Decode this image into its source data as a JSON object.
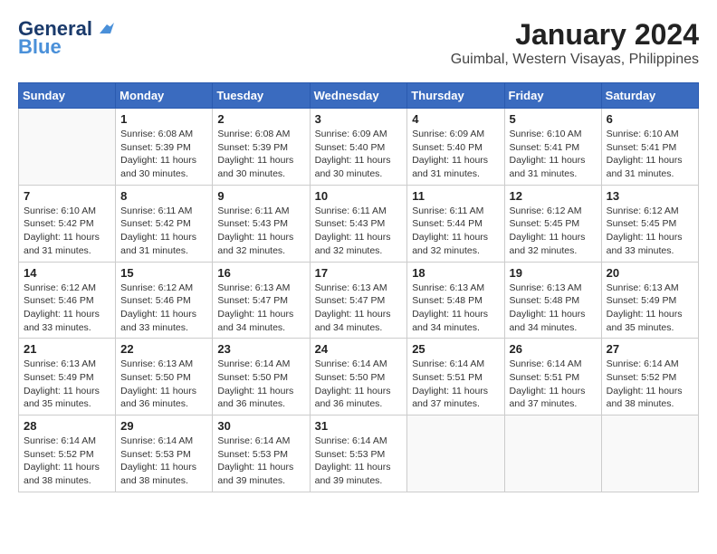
{
  "logo": {
    "line1": "General",
    "line2": "Blue"
  },
  "title": "January 2024",
  "subtitle": "Guimbal, Western Visayas, Philippines",
  "days_of_week": [
    "Sunday",
    "Monday",
    "Tuesday",
    "Wednesday",
    "Thursday",
    "Friday",
    "Saturday"
  ],
  "weeks": [
    [
      {
        "day": "",
        "info": ""
      },
      {
        "day": "1",
        "info": "Sunrise: 6:08 AM\nSunset: 5:39 PM\nDaylight: 11 hours\nand 30 minutes."
      },
      {
        "day": "2",
        "info": "Sunrise: 6:08 AM\nSunset: 5:39 PM\nDaylight: 11 hours\nand 30 minutes."
      },
      {
        "day": "3",
        "info": "Sunrise: 6:09 AM\nSunset: 5:40 PM\nDaylight: 11 hours\nand 30 minutes."
      },
      {
        "day": "4",
        "info": "Sunrise: 6:09 AM\nSunset: 5:40 PM\nDaylight: 11 hours\nand 31 minutes."
      },
      {
        "day": "5",
        "info": "Sunrise: 6:10 AM\nSunset: 5:41 PM\nDaylight: 11 hours\nand 31 minutes."
      },
      {
        "day": "6",
        "info": "Sunrise: 6:10 AM\nSunset: 5:41 PM\nDaylight: 11 hours\nand 31 minutes."
      }
    ],
    [
      {
        "day": "7",
        "info": "Sunrise: 6:10 AM\nSunset: 5:42 PM\nDaylight: 11 hours\nand 31 minutes."
      },
      {
        "day": "8",
        "info": "Sunrise: 6:11 AM\nSunset: 5:42 PM\nDaylight: 11 hours\nand 31 minutes."
      },
      {
        "day": "9",
        "info": "Sunrise: 6:11 AM\nSunset: 5:43 PM\nDaylight: 11 hours\nand 32 minutes."
      },
      {
        "day": "10",
        "info": "Sunrise: 6:11 AM\nSunset: 5:43 PM\nDaylight: 11 hours\nand 32 minutes."
      },
      {
        "day": "11",
        "info": "Sunrise: 6:11 AM\nSunset: 5:44 PM\nDaylight: 11 hours\nand 32 minutes."
      },
      {
        "day": "12",
        "info": "Sunrise: 6:12 AM\nSunset: 5:45 PM\nDaylight: 11 hours\nand 32 minutes."
      },
      {
        "day": "13",
        "info": "Sunrise: 6:12 AM\nSunset: 5:45 PM\nDaylight: 11 hours\nand 33 minutes."
      }
    ],
    [
      {
        "day": "14",
        "info": "Sunrise: 6:12 AM\nSunset: 5:46 PM\nDaylight: 11 hours\nand 33 minutes."
      },
      {
        "day": "15",
        "info": "Sunrise: 6:12 AM\nSunset: 5:46 PM\nDaylight: 11 hours\nand 33 minutes."
      },
      {
        "day": "16",
        "info": "Sunrise: 6:13 AM\nSunset: 5:47 PM\nDaylight: 11 hours\nand 34 minutes."
      },
      {
        "day": "17",
        "info": "Sunrise: 6:13 AM\nSunset: 5:47 PM\nDaylight: 11 hours\nand 34 minutes."
      },
      {
        "day": "18",
        "info": "Sunrise: 6:13 AM\nSunset: 5:48 PM\nDaylight: 11 hours\nand 34 minutes."
      },
      {
        "day": "19",
        "info": "Sunrise: 6:13 AM\nSunset: 5:48 PM\nDaylight: 11 hours\nand 34 minutes."
      },
      {
        "day": "20",
        "info": "Sunrise: 6:13 AM\nSunset: 5:49 PM\nDaylight: 11 hours\nand 35 minutes."
      }
    ],
    [
      {
        "day": "21",
        "info": "Sunrise: 6:13 AM\nSunset: 5:49 PM\nDaylight: 11 hours\nand 35 minutes."
      },
      {
        "day": "22",
        "info": "Sunrise: 6:13 AM\nSunset: 5:50 PM\nDaylight: 11 hours\nand 36 minutes."
      },
      {
        "day": "23",
        "info": "Sunrise: 6:14 AM\nSunset: 5:50 PM\nDaylight: 11 hours\nand 36 minutes."
      },
      {
        "day": "24",
        "info": "Sunrise: 6:14 AM\nSunset: 5:50 PM\nDaylight: 11 hours\nand 36 minutes."
      },
      {
        "day": "25",
        "info": "Sunrise: 6:14 AM\nSunset: 5:51 PM\nDaylight: 11 hours\nand 37 minutes."
      },
      {
        "day": "26",
        "info": "Sunrise: 6:14 AM\nSunset: 5:51 PM\nDaylight: 11 hours\nand 37 minutes."
      },
      {
        "day": "27",
        "info": "Sunrise: 6:14 AM\nSunset: 5:52 PM\nDaylight: 11 hours\nand 38 minutes."
      }
    ],
    [
      {
        "day": "28",
        "info": "Sunrise: 6:14 AM\nSunset: 5:52 PM\nDaylight: 11 hours\nand 38 minutes."
      },
      {
        "day": "29",
        "info": "Sunrise: 6:14 AM\nSunset: 5:53 PM\nDaylight: 11 hours\nand 38 minutes."
      },
      {
        "day": "30",
        "info": "Sunrise: 6:14 AM\nSunset: 5:53 PM\nDaylight: 11 hours\nand 39 minutes."
      },
      {
        "day": "31",
        "info": "Sunrise: 6:14 AM\nSunset: 5:53 PM\nDaylight: 11 hours\nand 39 minutes."
      },
      {
        "day": "",
        "info": ""
      },
      {
        "day": "",
        "info": ""
      },
      {
        "day": "",
        "info": ""
      }
    ]
  ]
}
